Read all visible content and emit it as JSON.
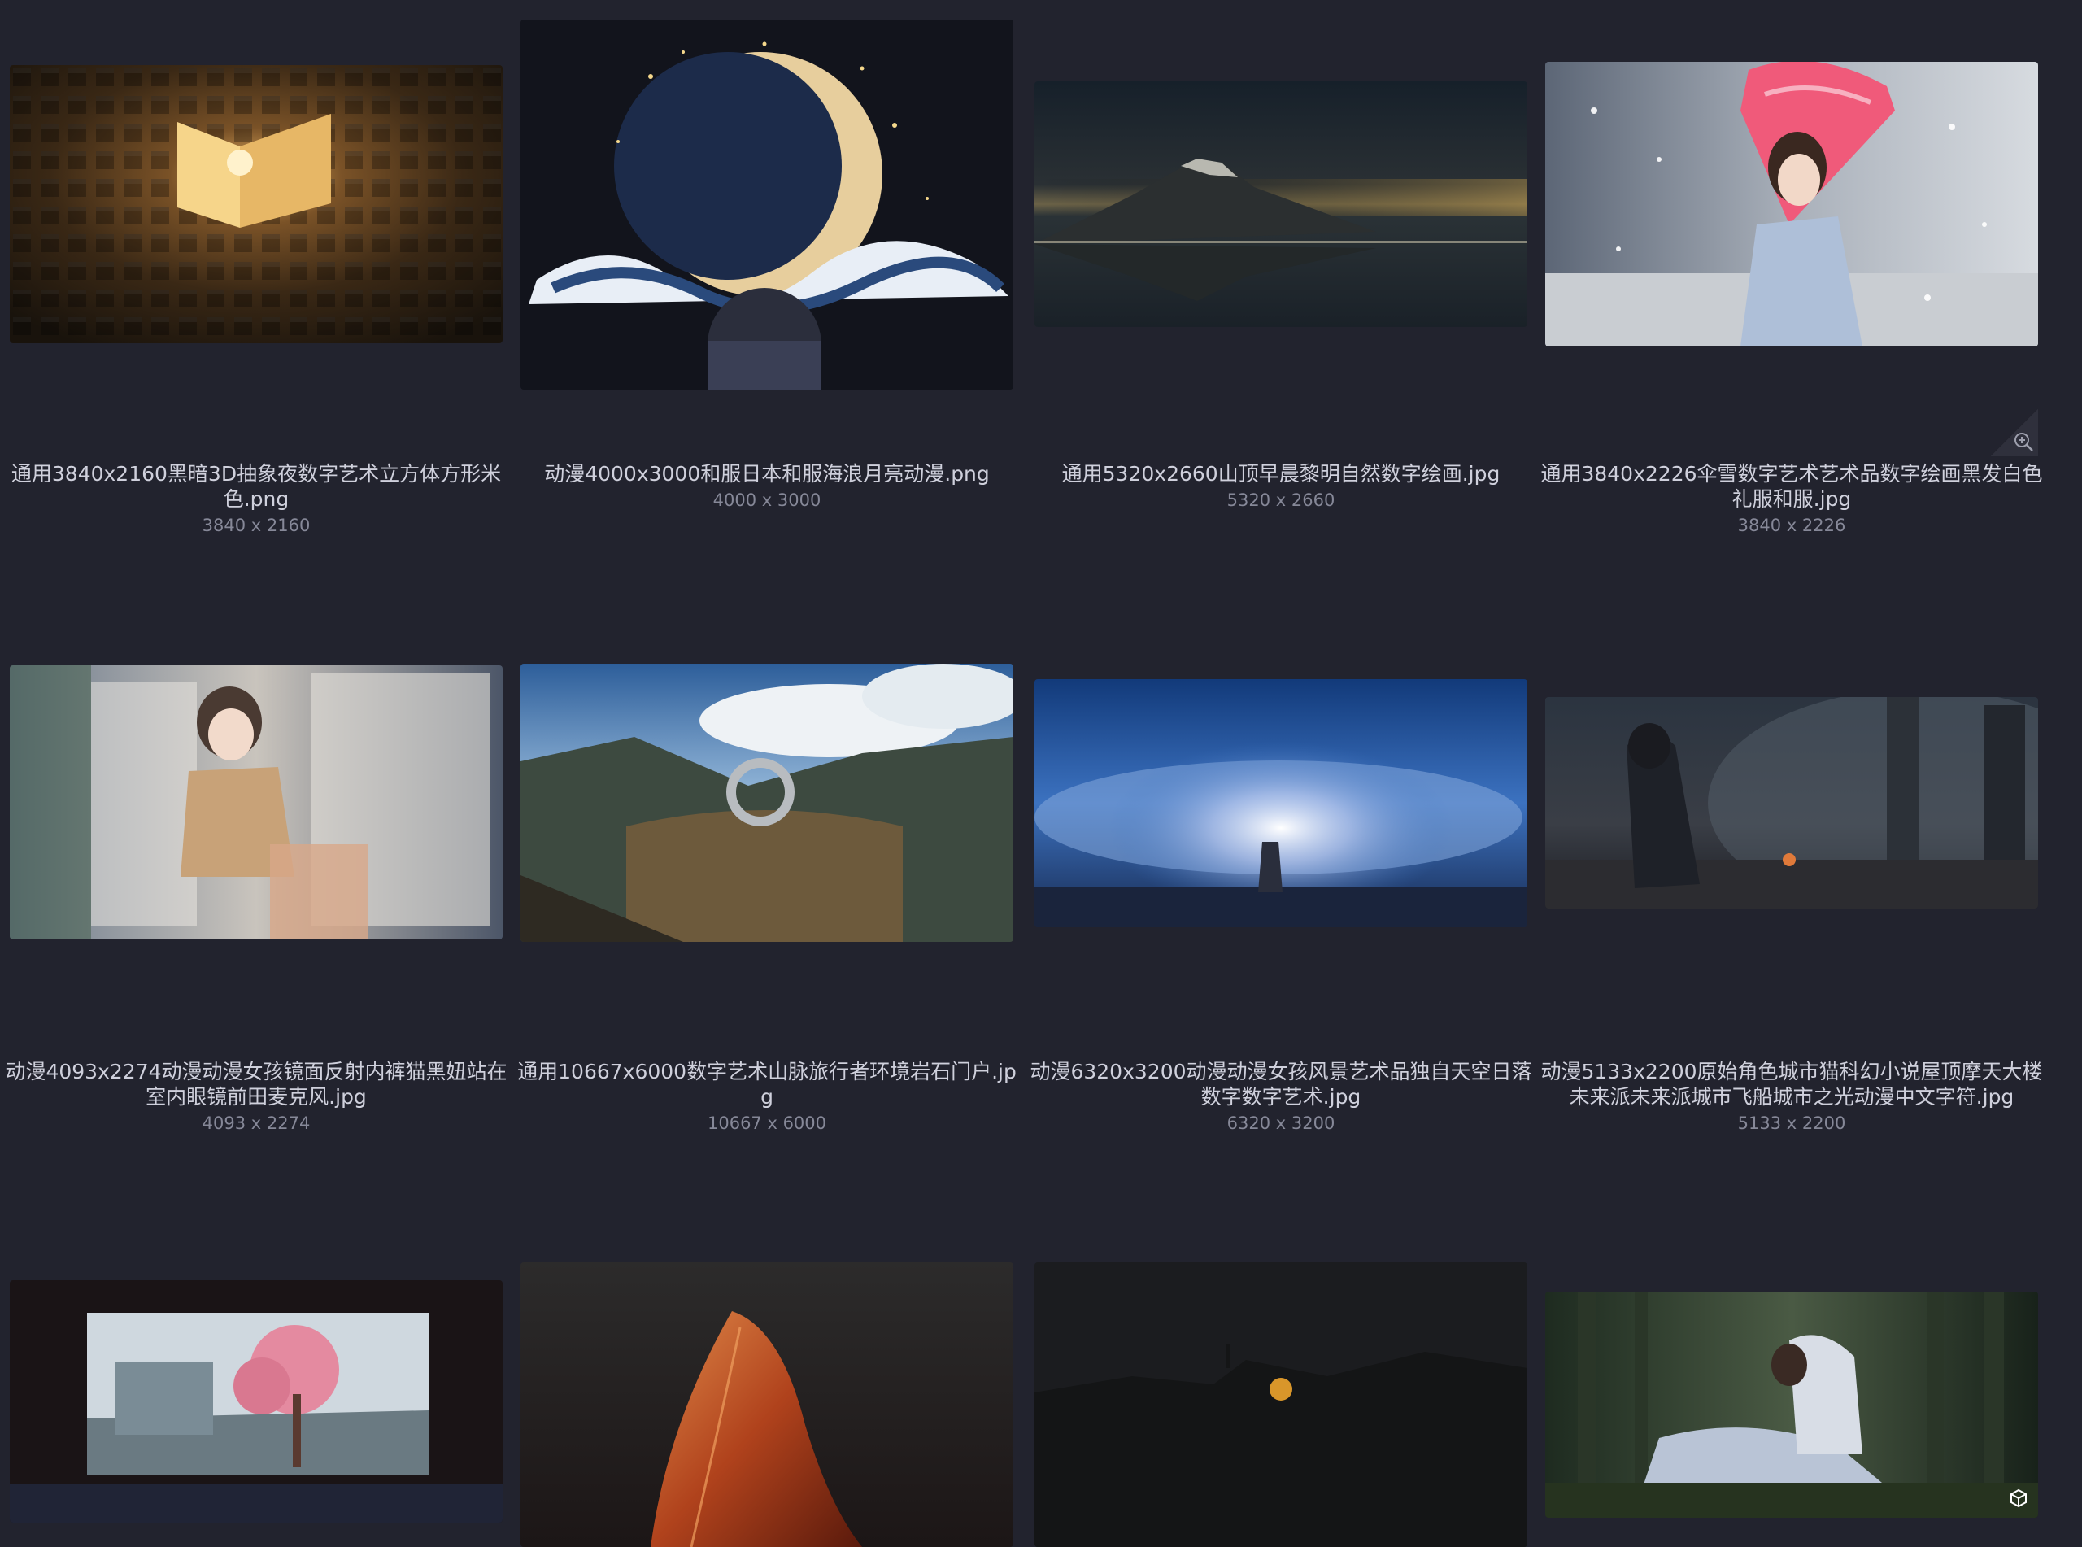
{
  "gallery": {
    "items": [
      {
        "title": "通用3840x2160黑暗3D抽象夜数字艺术立方体方形米色.png",
        "dims": "3840 x 2160"
      },
      {
        "title": "动漫4000x3000和服日本和服海浪月亮动漫.png",
        "dims": "4000 x 3000"
      },
      {
        "title": "通用5320x2660山顶早晨黎明自然数字绘画.jpg",
        "dims": "5320 x 2660"
      },
      {
        "title": "通用3840x2226伞雪数字艺术艺术品数字绘画黑发白色礼服和服.jpg",
        "dims": "3840 x 2226"
      },
      {
        "title": "动漫4093x2274动漫动漫女孩镜面反射内裤猫黑妞站在室内眼镜前田麦克风.jpg",
        "dims": "4093 x 2274"
      },
      {
        "title": "通用10667x6000数字艺术山脉旅行者环境岩石门户.jpg",
        "dims": "10667 x 6000"
      },
      {
        "title": "动漫6320x3200动漫动漫女孩风景艺术品独自天空日落数字数字艺术.jpg",
        "dims": "6320 x 3200"
      },
      {
        "title": "动漫5133x2200原始角色城市猫科幻小说屋顶摩天大楼未来派未来派城市飞船城市之光动漫中文字符.jpg",
        "dims": "5133 x 2200"
      }
    ],
    "icons": {
      "zoom": "zoom-in-icon",
      "model": "cube-icon"
    }
  }
}
